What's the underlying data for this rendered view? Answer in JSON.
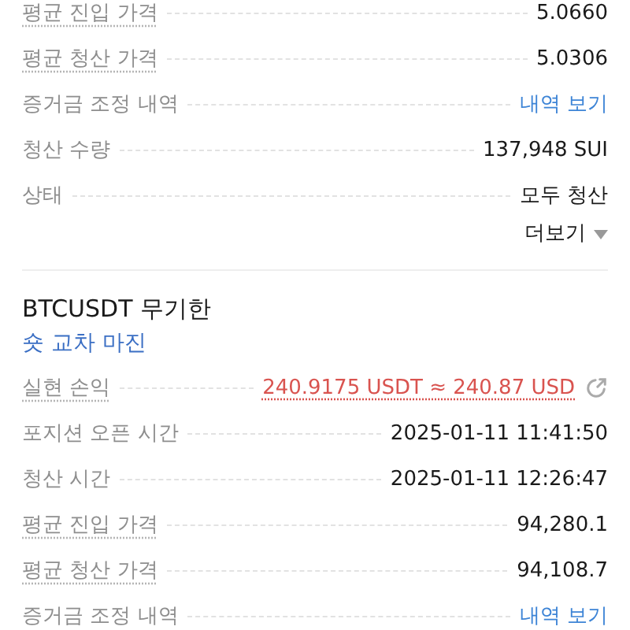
{
  "sections": [
    {
      "rows": [
        {
          "label": "평균 진입 가격",
          "value": "5.0660",
          "kind": "text",
          "underlined": true
        },
        {
          "label": "평균 청산 가격",
          "value": "5.0306",
          "kind": "text",
          "underlined": true
        },
        {
          "label": "증거금 조정 내역",
          "value": "내역 보기",
          "kind": "link",
          "underlined": false
        },
        {
          "label": "청산 수량",
          "value": "137,948 SUI",
          "kind": "text",
          "underlined": false
        },
        {
          "label": "상태",
          "value": "모두 청산",
          "kind": "text",
          "underlined": false
        }
      ],
      "more": {
        "label": "더보기"
      }
    },
    {
      "title": "BTCUSDT 무기한",
      "subtitle": "숏 교차 마진",
      "rows": [
        {
          "label": "실현 손익",
          "value": "240.9175 USDT ≈ 240.87 USD",
          "kind": "pnl",
          "underlined": true
        },
        {
          "label": "포지션 오픈 시간",
          "value": "2025-01-11 11:41:50",
          "kind": "text",
          "underlined": false
        },
        {
          "label": "청산 시간",
          "value": "2025-01-11 12:26:47",
          "kind": "text",
          "underlined": false
        },
        {
          "label": "평균 진입 가격",
          "value": "94,280.1",
          "kind": "text",
          "underlined": true
        },
        {
          "label": "평균 청산 가격",
          "value": "94,108.7",
          "kind": "text",
          "underlined": true
        },
        {
          "label": "증거금 조정 내역",
          "value": "내역 보기",
          "kind": "link",
          "underlined": false
        }
      ]
    }
  ]
}
